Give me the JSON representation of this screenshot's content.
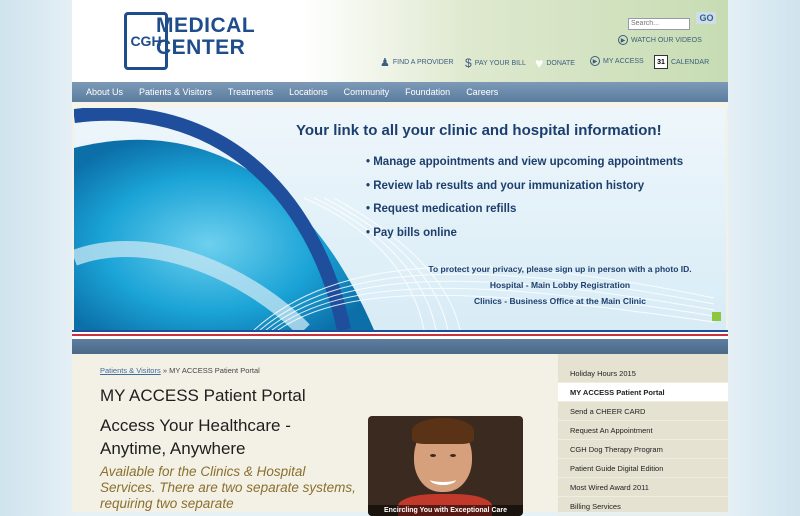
{
  "logo": {
    "mark": "CGH",
    "line1": "MEDICAL",
    "line2": "CENTER"
  },
  "search": {
    "placeholder": "Search...",
    "go": "GO"
  },
  "utility": {
    "watch_videos": "WATCH OUR VIDEOS",
    "find_provider": "FIND A PROVIDER",
    "pay_bill": "PAY YOUR BILL",
    "donate": "DONATE",
    "my_access": "MY ACCESS",
    "calendar_day": "31",
    "calendar": "CALENDAR"
  },
  "nav": [
    "About Us",
    "Patients & Visitors",
    "Treatments",
    "Locations",
    "Community",
    "Foundation",
    "Careers"
  ],
  "banner": {
    "headline": "Your link to all your clinic and hospital information!",
    "bullets": [
      "• Manage appointments and view upcoming appointments",
      "• Review lab results and your immunization history",
      "• Request medication refills",
      "• Pay bills online"
    ],
    "note1": "To protect your privacy, please sign up in person with a photo ID.",
    "note2": "Hospital - Main Lobby Registration",
    "note3": "Clinics - Business Office at the Main Clinic"
  },
  "breadcrumb": {
    "link": "Patients & Visitors",
    "sep": " » ",
    "current": "MY ACCESS Patient Portal"
  },
  "page": {
    "title": "MY ACCESS Patient Portal",
    "subtitle": "Access Your Healthcare - Anytime, Anywhere",
    "intro": "Available for the Clinics & Hospital Services.  There are two separate systems, requiring two separate"
  },
  "photo_caption": "Encircling You with Exceptional Care",
  "sidebar": [
    "Holiday Hours 2015",
    "MY ACCESS Patient Portal",
    "Send a CHEER CARD",
    "Request An Appointment",
    "CGH Dog Therapy Program",
    "Patient Guide Digital Edition",
    "Most Wired Award 2011",
    "Billing Services"
  ],
  "sidebar_active_index": 1,
  "colors": {
    "nav": "#6a8aab",
    "brand": "#1f4c8a",
    "accent_green": "#8dc63f",
    "stripe_red": "#c8323c"
  }
}
